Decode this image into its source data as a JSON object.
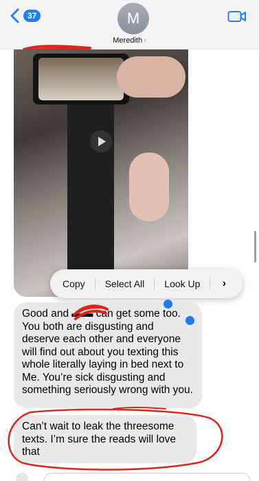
{
  "header": {
    "unread_count": "37",
    "avatar_initial": "M",
    "contact_name": "Meredith",
    "contact_chevron": "›",
    "icons": {
      "back": "chevron-left-icon",
      "video": "video-camera-icon"
    }
  },
  "context_menu": {
    "items": [
      "Copy",
      "Select All",
      "Look Up"
    ],
    "more": "›"
  },
  "messages": [
    {
      "id": "msg1",
      "text": "Good and ▬▬ can get some too. You both are disgusting and deserve each other and everyone will find out about you texting this whole literally laying in bed next to Me. You’re sick disgusting and something seriously wrong with you."
    },
    {
      "id": "msg2",
      "text": "Can’t wait to leak the threesome texts. I’m sure the reads will love that"
    }
  ],
  "colors": {
    "accent": "#1b82f8",
    "bubble_received": "#e9e9eb",
    "annotation_red": "#e0231b"
  }
}
